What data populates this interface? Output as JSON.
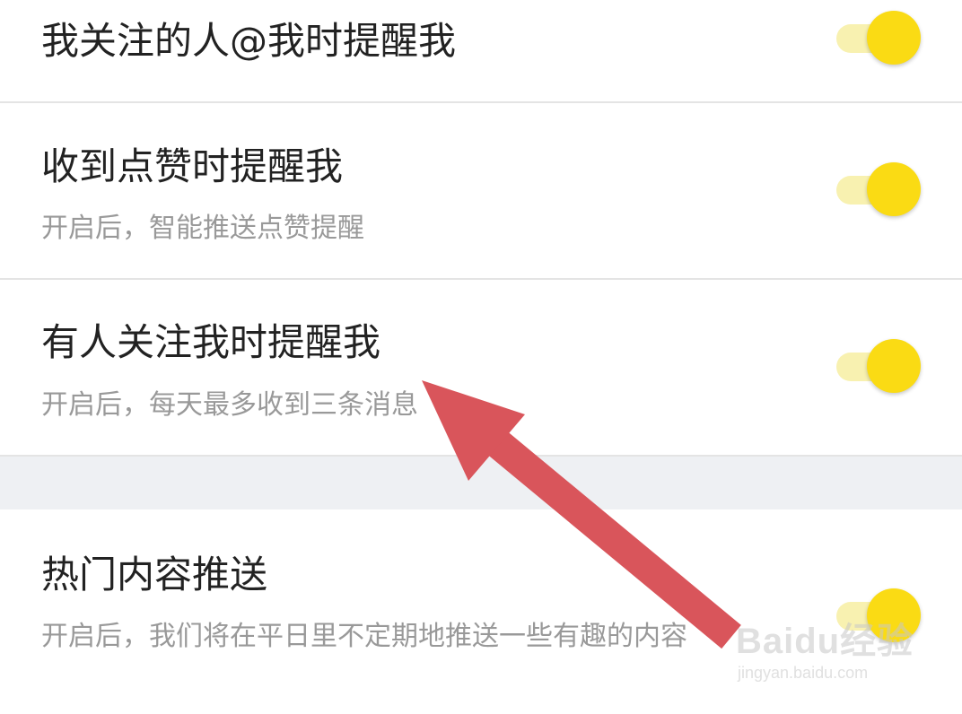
{
  "settings": [
    {
      "title": "我关注的人@我时提醒我",
      "description": "",
      "enabled": true
    },
    {
      "title": "收到点赞时提醒我",
      "description": "开启后，智能推送点赞提醒",
      "enabled": true
    },
    {
      "title": "有人关注我时提醒我",
      "description": "开启后，每天最多收到三条消息",
      "enabled": true
    },
    {
      "title": "热门内容推送",
      "description": "开启后，我们将在平日里不定期地推送一些有趣的内容",
      "enabled": true
    }
  ],
  "colors": {
    "toggle_on": "#fadb14",
    "annotation_arrow": "#d9555b"
  },
  "watermark": {
    "brand": "Baidu经验",
    "url": "jingyan.baidu.com"
  }
}
